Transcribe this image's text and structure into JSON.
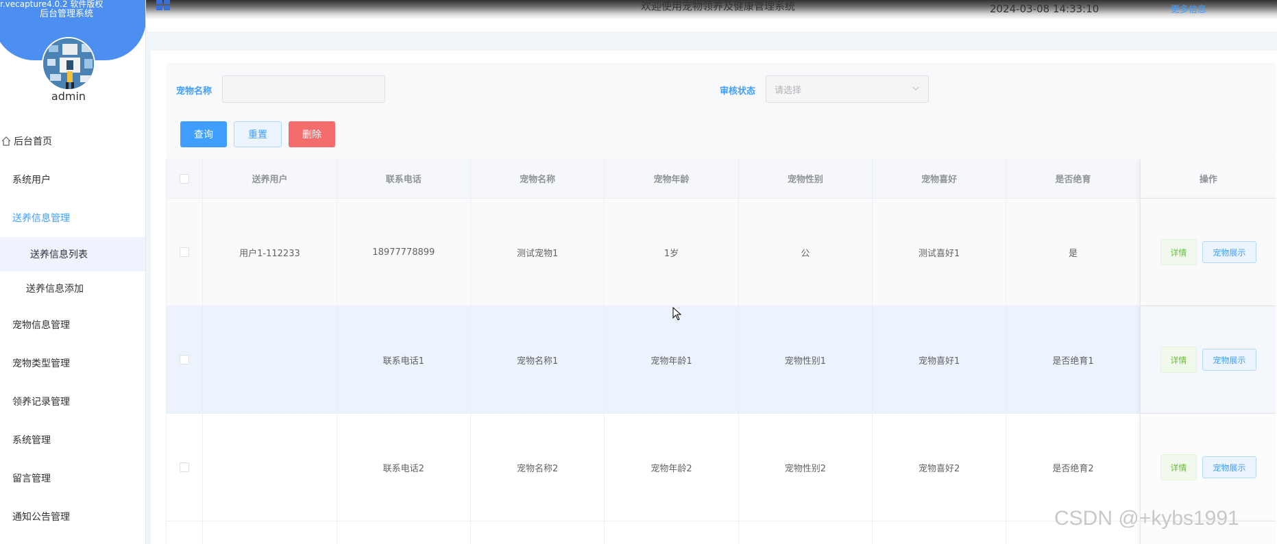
{
  "sidebar": {
    "cap_text_1": "r.vecapture4.0.2 软件版权",
    "cap_text_2": "后台管理系统",
    "user": "admin",
    "items": [
      {
        "label": "后台首页"
      },
      {
        "label": "系统用户"
      },
      {
        "label": "送养信息管理"
      },
      {
        "label": "送养信息列表"
      },
      {
        "label": "送养信息添加"
      },
      {
        "label": "宠物信息管理"
      },
      {
        "label": "宠物类型管理"
      },
      {
        "label": "领养记录管理"
      },
      {
        "label": "系统管理"
      },
      {
        "label": "留言管理"
      },
      {
        "label": "通知公告管理"
      }
    ]
  },
  "topbar": {
    "title": "欢迎使用宠物领养及健康管理系统",
    "datetime": "2024-03-08 14:33:10",
    "more": "更多信息"
  },
  "search": {
    "pet_name_label": "宠物名称",
    "pet_name_value": "",
    "status_label": "审核状态",
    "status_placeholder": "请选择",
    "query_btn": "查询",
    "reset_btn": "重置",
    "delete_btn": "删除"
  },
  "table": {
    "headers": [
      "送养用户",
      "联系电话",
      "宠物名称",
      "宠物年龄",
      "宠物性别",
      "宠物喜好",
      "是否绝育",
      "操作"
    ],
    "rows": [
      [
        "用户1-112233",
        "18977778899",
        "测试宠物1",
        "1岁",
        "公",
        "测试喜好1",
        "是"
      ],
      [
        "",
        "联系电话1",
        "宠物名称1",
        "宠物年龄1",
        "宠物性别1",
        "宠物喜好1",
        "是否绝育1"
      ],
      [
        "",
        "联系电话2",
        "宠物名称2",
        "宠物年龄2",
        "宠物性别2",
        "宠物喜好2",
        "是否绝育2"
      ]
    ],
    "detail_btn": "详情",
    "show_btn": "宠物展示"
  },
  "watermark": "CSDN @+kybs1991",
  "colors": {
    "primary": "#409eff",
    "danger": "#f56c6c",
    "success": "#67c23a",
    "sidebar_cap": "#4d8ff0"
  }
}
